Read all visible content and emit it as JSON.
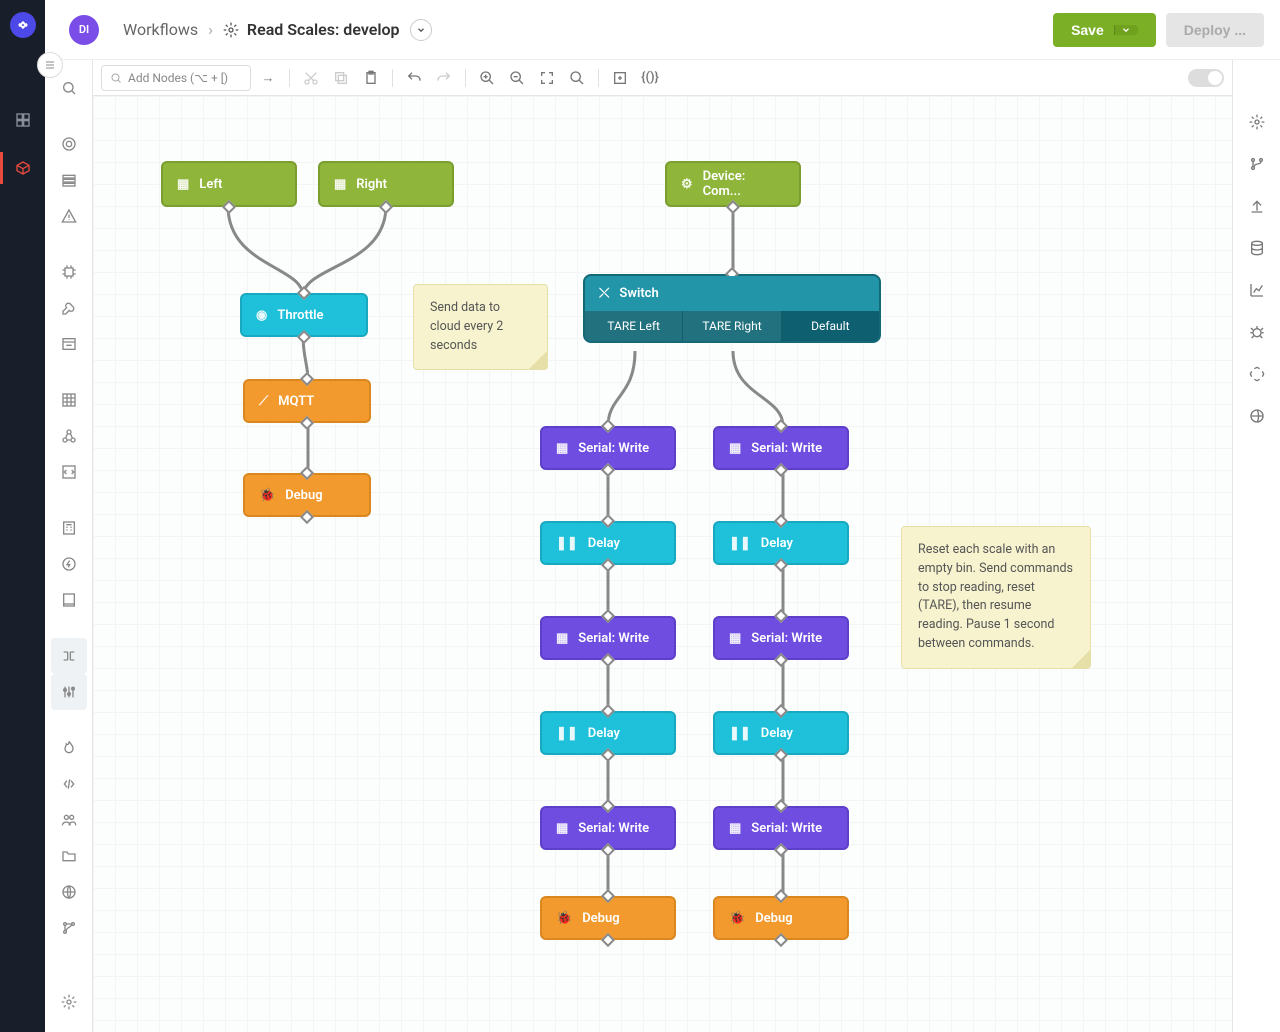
{
  "header": {
    "avatar": "DI",
    "breadcrumb_root": "Workflows",
    "title": "Read Scales: develop",
    "save": "Save",
    "deploy": "Deploy ..."
  },
  "toolbar": {
    "search_placeholder": "Add Nodes (⌥ + [)"
  },
  "notes": {
    "n1": "Send data to cloud every 2 seconds",
    "n2": "Reset each scale with an empty bin. Send commands to stop reading, reset (TARE), then resume reading. Pause 1 second between commands."
  },
  "nodes": {
    "left": "Left",
    "right": "Right",
    "device_cmd": "Device: Com...",
    "throttle": "Throttle",
    "mqtt": "MQTT",
    "debug": "Debug",
    "switch": "Switch",
    "tare_left": "TARE Left",
    "tare_right": "TARE Right",
    "default": "Default",
    "serial_write": "Serial: Write",
    "delay": "Delay"
  }
}
